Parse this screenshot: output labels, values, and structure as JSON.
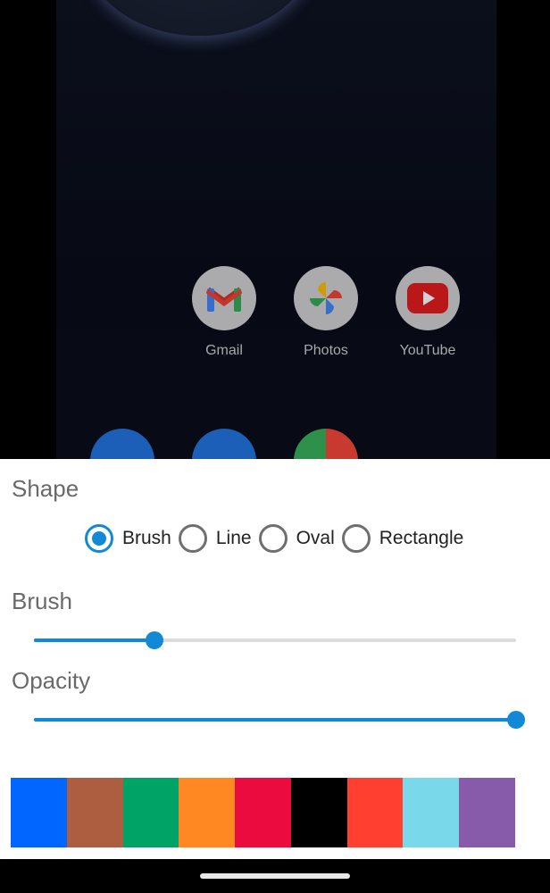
{
  "home_apps": [
    {
      "label": "Gmail",
      "icon": "gmail-icon"
    },
    {
      "label": "Photos",
      "icon": "photos-icon"
    },
    {
      "label": "YouTube",
      "icon": "youtube-icon"
    }
  ],
  "sheet": {
    "shape_title": "Shape",
    "shape_options": [
      {
        "label": "Brush",
        "checked": true
      },
      {
        "label": "Line",
        "checked": false
      },
      {
        "label": "Oval",
        "checked": false
      },
      {
        "label": "Rectangle",
        "checked": false
      }
    ],
    "brush_title": "Brush",
    "brush_value": 0.25,
    "opacity_title": "Opacity",
    "opacity_value": 1.0,
    "palette": [
      "#0066ff",
      "#ad5e40",
      "#00a366",
      "#ff8822",
      "#eb0b3f",
      "#000000",
      "#ff4031",
      "#79d8ea",
      "#875ba9"
    ]
  },
  "colors": {
    "accent": "#1189d6"
  }
}
